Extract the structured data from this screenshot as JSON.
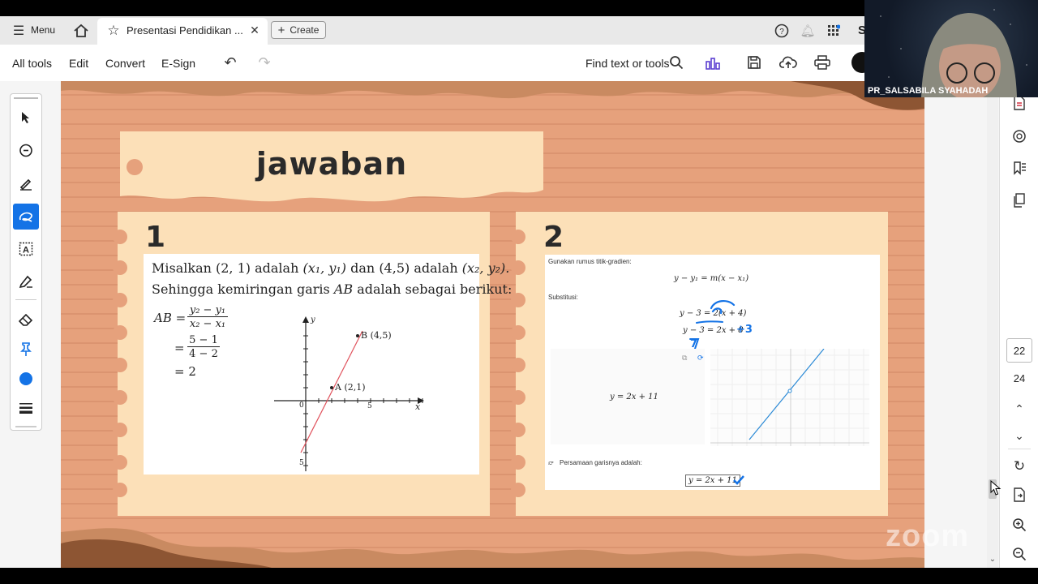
{
  "tabbar": {
    "menu_label": "Menu",
    "tab_title": "Presentasi Pendidikan ...",
    "create_label": "Create"
  },
  "toolbar": {
    "all_tools": "All tools",
    "edit": "Edit",
    "convert": "Convert",
    "esign": "E-Sign",
    "find": "Find text or tools"
  },
  "slide": {
    "title": "jawaban",
    "panel1": {
      "number": "1",
      "line1_a": "Misalkan",
      "line1_b": "(2, 1)",
      "line1_c": "adalah",
      "line1_d": "(x₁, y₁)",
      "line1_e": "dan",
      "line1_f": "(4,5)",
      "line1_g": "adalah",
      "line1_h": "(x₂, y₂).",
      "line2_a": "Sehingga kemiringan garis",
      "line2_b": "AB",
      "line2_c": "adalah sebagai berikut:",
      "eq_lhs": "AB =",
      "eq1_num": "y₂ − y₁",
      "eq1_den": "x₂ − x₁",
      "eq2_num": "5 − 1",
      "eq2_den": "4 − 2",
      "eq3": "= 2",
      "graph": {
        "y_label": "y",
        "x_label": "x",
        "origin": "0",
        "tick_x5": "5",
        "tick_y5": "5",
        "point_a": "A (2,1)",
        "point_b": "B (4,5)"
      }
    },
    "panel2": {
      "number": "2",
      "intro": "Gunakan rumus titik-gradien:",
      "formula": "y − y₁ = m(x − x₁)",
      "subst_label": "Substitusi:",
      "step1": "y − 3 = 2(x + 4)",
      "step2": "y − 3 = 2x + 8",
      "result_left": "y = 2x + 11",
      "answer_label": "Persamaan garisnya adalah:",
      "answer": "y = 2x + 11",
      "annot_plus3": "+3",
      "annot_num": "7"
    }
  },
  "right_panel": {
    "page_current": "22",
    "page_total": "24"
  },
  "video": {
    "name": "PR_SALSABILA SYAHADAH",
    "watermark": "zoom"
  },
  "colors": {
    "slide_bg": "#e6a17c",
    "card": "#fce0b8",
    "accent_blue": "#1473e6",
    "graph_line_red": "#e0525c",
    "graph_line_blue": "#2b8ad6"
  }
}
